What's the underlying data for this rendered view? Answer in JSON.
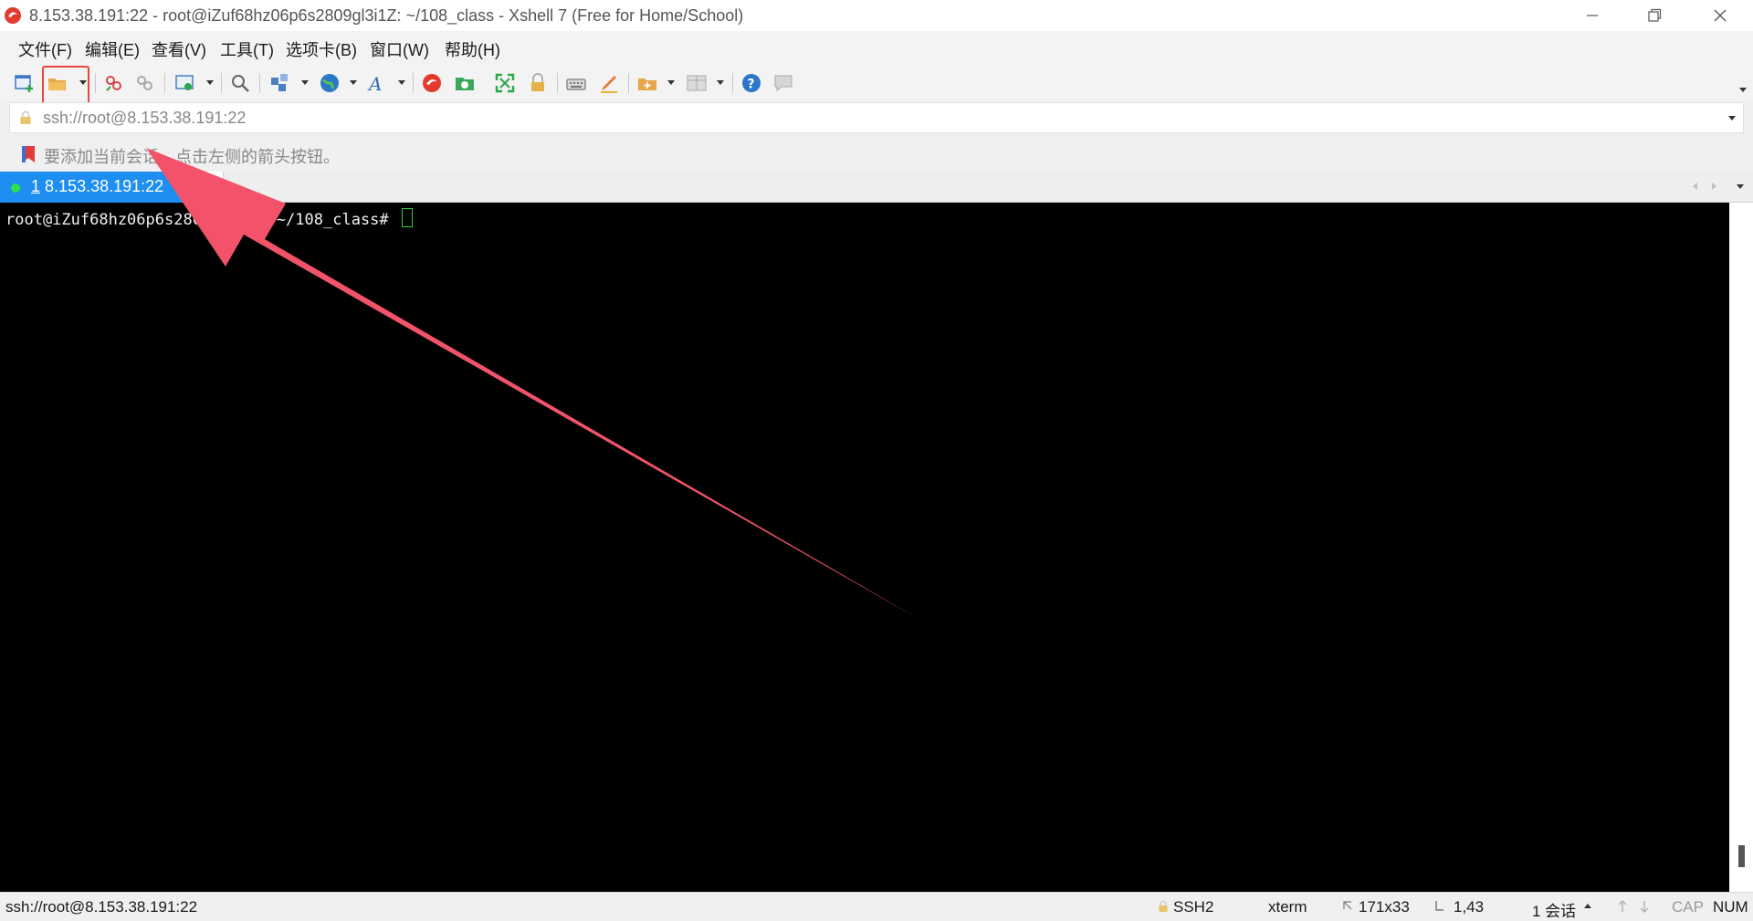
{
  "window": {
    "title": "8.153.38.191:22 - root@iZuf68hz06p6s2809gl3i1Z: ~/108_class - Xshell 7 (Free for Home/School)"
  },
  "menu": {
    "items": [
      "文件(F)",
      "编辑(E)",
      "查看(V)",
      "工具(T)",
      "选项卡(B)",
      "窗口(W)",
      "帮助(H)"
    ]
  },
  "toolbar": {
    "icons": [
      "new-session-icon",
      "open-folder-icon",
      "reconnect-icon",
      "disconnect-icon",
      "session-properties-icon",
      "find-icon",
      "transfer-icon",
      "globe-icon",
      "font-icon",
      "xshell-icon",
      "xftp-icon",
      "fullscreen-icon",
      "lock-icon",
      "keyboard-icon",
      "highlight-icon",
      "compose-icon",
      "layout-icon",
      "help-icon",
      "chat-icon"
    ]
  },
  "addressbar": {
    "value": "ssh://root@8.153.38.191:22"
  },
  "quickbar": {
    "text": "要添加当前会话，点击左侧的箭头按钮。"
  },
  "tab": {
    "index": "1",
    "label": "8.153.38.191:22"
  },
  "terminal": {
    "prompt": "root@iZuf68hz06p6s2809gl3i1Z:~/108_class# "
  },
  "statusbar": {
    "connection": "ssh://root@8.153.38.191:22",
    "protocol": "SSH2",
    "terminal_type": "xterm",
    "size": "171x33",
    "position": "1,43",
    "sessions": "1 会话",
    "cap": "CAP",
    "num": "NUM"
  },
  "colors": {
    "tab_active": "#1e8ff0",
    "annotation_arrow": "#f2536a",
    "highlight_box": "#e8453c",
    "terminal_bg": "#000000",
    "cursor": "#2fd14a"
  }
}
